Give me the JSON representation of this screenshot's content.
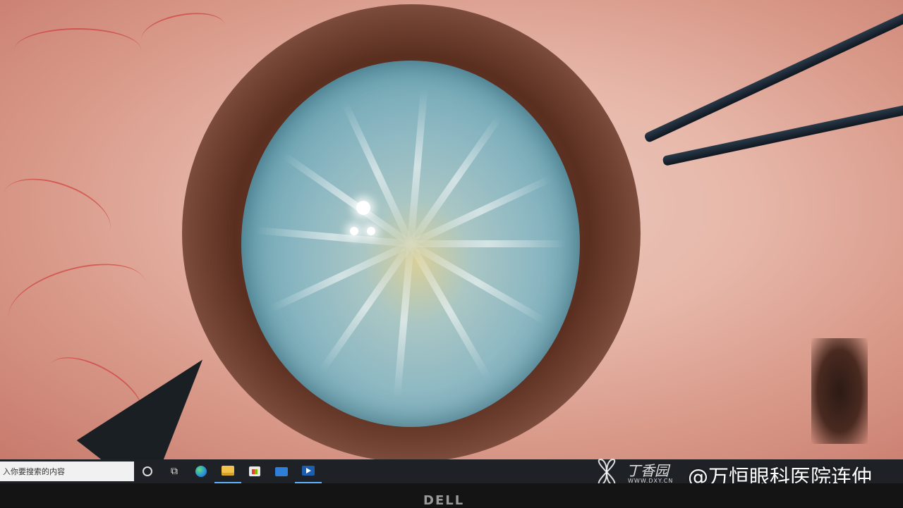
{
  "taskbar": {
    "search_text": "入你要搜索的内容",
    "icons": [
      "cortana-icon",
      "task-view-icon",
      "edge-icon",
      "file-explorer-icon",
      "store-icon",
      "mail-icon",
      "media-player-icon"
    ],
    "accent_color": "#5fb3ff"
  },
  "watermark": {
    "brand": "丁香园",
    "url": "WWW.DXY.CN",
    "credit": "@万恒眼科医院连仲"
  },
  "monitor": {
    "logo": "DELL"
  }
}
